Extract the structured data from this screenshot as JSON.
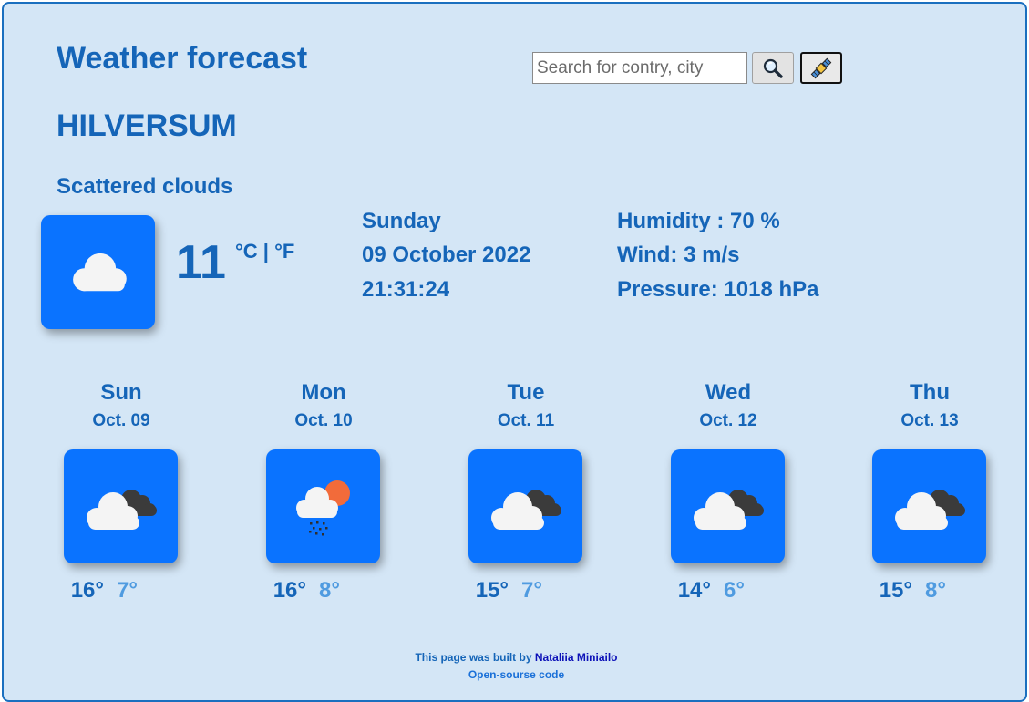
{
  "header": {
    "title": "Weather forecast",
    "search_placeholder": "Search for contry, city",
    "search_button_icon": "magnifier-icon",
    "location_button_icon": "satellite-icon"
  },
  "current": {
    "city": "HILVERSUM",
    "description": "Scattered clouds",
    "icon": "cloud-icon",
    "temperature": "11",
    "unit_celsius": "°C",
    "unit_separator": " | ",
    "unit_fahrenheit": "°F",
    "day": "Sunday",
    "date": "09 October 2022",
    "time": "21:31:24",
    "humidity": "Humidity : 70 %",
    "wind": "Wind: 3 m/s",
    "pressure": "Pressure: 1018 hPa"
  },
  "forecast": [
    {
      "day": "Sun",
      "date": "Oct. 09",
      "icon": "cloudy-icon",
      "max": "16°",
      "min": "7°"
    },
    {
      "day": "Mon",
      "date": "Oct. 10",
      "icon": "sun-rain-cloud-icon",
      "max": "16°",
      "min": "8°"
    },
    {
      "day": "Tue",
      "date": "Oct. 11",
      "icon": "cloudy-icon",
      "max": "15°",
      "min": "7°"
    },
    {
      "day": "Wed",
      "date": "Oct. 12",
      "icon": "cloudy-icon",
      "max": "14°",
      "min": "6°"
    },
    {
      "day": "Thu",
      "date": "Oct. 13",
      "icon": "cloudy-icon",
      "max": "15°",
      "min": "8°"
    }
  ],
  "footer": {
    "built_by_text": "This page was built by ",
    "author": "Nataliia Miniailo",
    "source_link": "Open-sourse code"
  },
  "colors": {
    "background": "#d4e6f6",
    "accent": "#1565b8",
    "icon_tile": "#0a73ff",
    "min_temp": "#4f9be0"
  }
}
